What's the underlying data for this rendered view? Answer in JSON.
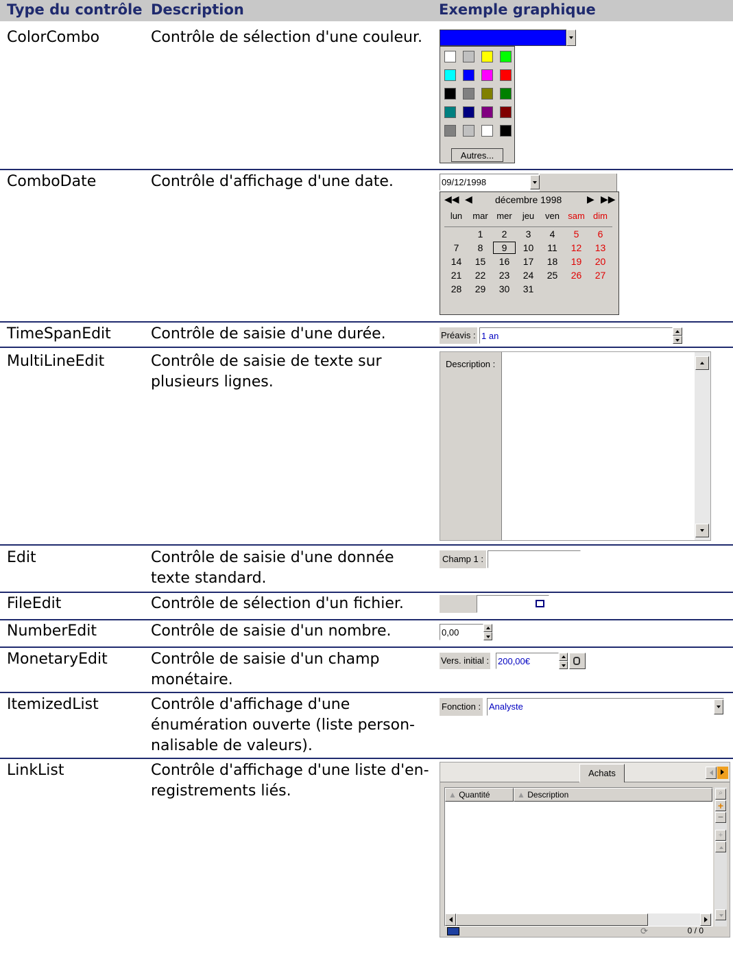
{
  "headers": {
    "type": "Type du contrôle",
    "description": "Description",
    "example": "Exemple graphique"
  },
  "rows": [
    {
      "type": "ColorCombo",
      "description": "Contrôle de sélection d'une couleur."
    },
    {
      "type": "ComboDate",
      "description": "Contrôle d'affichage d'une date."
    },
    {
      "type": "TimeSpanEdit",
      "description": "Contrôle de saisie d'une durée."
    },
    {
      "type": "MultiLineEdit",
      "description": "Contrôle de saisie de texte sur plusieurs lignes."
    },
    {
      "type": "Edit",
      "description": "Contrôle de saisie d'une donnée texte standard."
    },
    {
      "type": "FileEdit",
      "description": "Contrôle de sélection d'un fichier."
    },
    {
      "type": "NumberEdit",
      "description": "Contrôle de saisie d'un nombre."
    },
    {
      "type": "MonetaryEdit",
      "description": "Contrôle de saisie d'un champ monétaire."
    },
    {
      "type": "ItemizedList",
      "description": "Contrôle d'affichage d'une énumération ouverte (liste person-nalisable de valeurs)."
    },
    {
      "type": "LinkList",
      "description": "Contrôle d'affichage d'une liste d'en-registrements liés."
    }
  ],
  "colorcombo": {
    "selected_color": "#0000ff",
    "swatches": [
      "#ffffff",
      "#c0c0c0",
      "#ffff00",
      "#00ff00",
      "#00ffff",
      "#0000ff",
      "#ff00ff",
      "#ff0000",
      "#000000",
      "#808080",
      "#808000",
      "#008000",
      "#008080",
      "#000080",
      "#800080",
      "#800000",
      "#808080",
      "#c0c0c0",
      "#ffffff",
      "#000000"
    ],
    "more_label": "Autres..."
  },
  "combodate": {
    "value": "09/12/1998",
    "month_label": "décembre 1998",
    "days": [
      "lun",
      "mar",
      "mer",
      "jeu",
      "ven",
      "sam",
      "dim"
    ],
    "weeks": [
      [
        "",
        "",
        "",
        "",
        "",
        "",
        ""
      ],
      [
        "",
        "1",
        "2",
        "3",
        "4",
        "5",
        "6"
      ],
      [
        "7",
        "8",
        "9",
        "10",
        "11",
        "12",
        "13"
      ],
      [
        "14",
        "15",
        "16",
        "17",
        "18",
        "19",
        "20"
      ],
      [
        "21",
        "22",
        "23",
        "24",
        "25",
        "26",
        "27"
      ],
      [
        "28",
        "29",
        "30",
        "31",
        "",
        "",
        ""
      ]
    ],
    "selected_day": "9"
  },
  "timespan": {
    "label": "Préavis :",
    "value": "1 an"
  },
  "multiline": {
    "label": "Description :"
  },
  "edit": {
    "label": "Champ 1 :"
  },
  "number": {
    "value": "0,00"
  },
  "monetary": {
    "label": "Vers. initial :",
    "value": "200,00€"
  },
  "itemized": {
    "label": "Fonction :",
    "value": "Analyste"
  },
  "linklist": {
    "tab": "Achats",
    "col1": "Quantité",
    "col2": "Description",
    "counter": "0 / 0"
  }
}
